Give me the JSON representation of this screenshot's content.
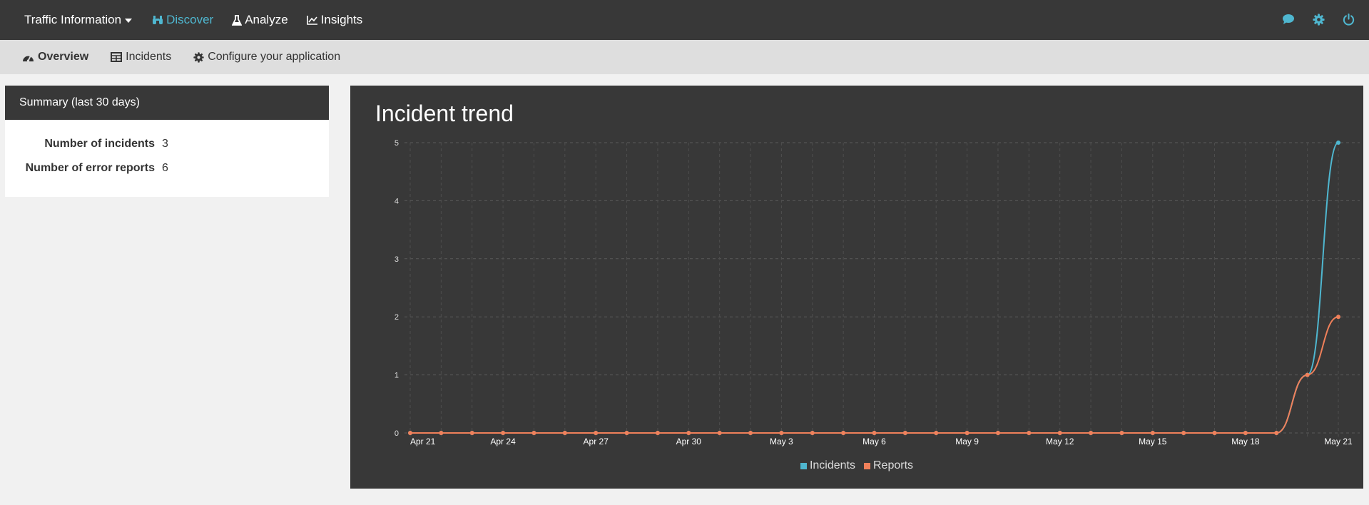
{
  "topbar": {
    "app_name": "Traffic Information",
    "nav": [
      {
        "label": "Discover",
        "icon": "binoculars-icon",
        "active": true
      },
      {
        "label": "Analyze",
        "icon": "flask-icon",
        "active": false
      },
      {
        "label": "Insights",
        "icon": "line-chart-icon",
        "active": false
      }
    ],
    "right_icons": [
      "chat-icon",
      "gear-icon",
      "power-icon"
    ],
    "accent_color": "#4fb7d0"
  },
  "subnav": [
    {
      "label": "Overview",
      "icon": "dashboard-icon",
      "active": true
    },
    {
      "label": "Incidents",
      "icon": "table-icon",
      "active": false
    },
    {
      "label": "Configure your application",
      "icon": "gear-icon",
      "active": false
    }
  ],
  "summary": {
    "title": "Summary (last 30 days)",
    "rows": [
      {
        "label": "Number of incidents",
        "value": "3"
      },
      {
        "label": "Number of error reports",
        "value": "6"
      }
    ]
  },
  "chart_title": "Incident trend",
  "chart_data": {
    "type": "line",
    "x": [
      "2019-04-21",
      "2019-04-22",
      "2019-04-23",
      "2019-04-24",
      "2019-04-25",
      "2019-04-26",
      "2019-04-27",
      "2019-04-28",
      "2019-04-29",
      "2019-04-30",
      "2019-05-01",
      "2019-05-02",
      "2019-05-03",
      "2019-05-04",
      "2019-05-05",
      "2019-05-06",
      "2019-05-07",
      "2019-05-08",
      "2019-05-09",
      "2019-05-10",
      "2019-05-11",
      "2019-05-12",
      "2019-05-13",
      "2019-05-14",
      "2019-05-15",
      "2019-05-16",
      "2019-05-17",
      "2019-05-18",
      "2019-05-19",
      "2019-05-20",
      "2019-05-21"
    ],
    "x_tick_labels": [
      "Apr 21",
      "Apr 24",
      "Apr 27",
      "Apr 30",
      "May 3",
      "May 6",
      "May 9",
      "May 12",
      "May 15",
      "May 18",
      "May 21"
    ],
    "y_ticks": [
      0,
      1,
      2,
      3,
      4,
      5
    ],
    "ylim": [
      0,
      5
    ],
    "grid": true,
    "legend_position": "bottom",
    "series": [
      {
        "name": "Incidents",
        "color": "#4fb7d0",
        "values": [
          0,
          0,
          0,
          0,
          0,
          0,
          0,
          0,
          0,
          0,
          0,
          0,
          0,
          0,
          0,
          0,
          0,
          0,
          0,
          0,
          0,
          0,
          0,
          0,
          0,
          0,
          0,
          0,
          0,
          1,
          5
        ]
      },
      {
        "name": "Reports",
        "color": "#f0805a",
        "values": [
          0,
          0,
          0,
          0,
          0,
          0,
          0,
          0,
          0,
          0,
          0,
          0,
          0,
          0,
          0,
          0,
          0,
          0,
          0,
          0,
          0,
          0,
          0,
          0,
          0,
          0,
          0,
          0,
          0,
          1,
          2
        ]
      }
    ]
  }
}
